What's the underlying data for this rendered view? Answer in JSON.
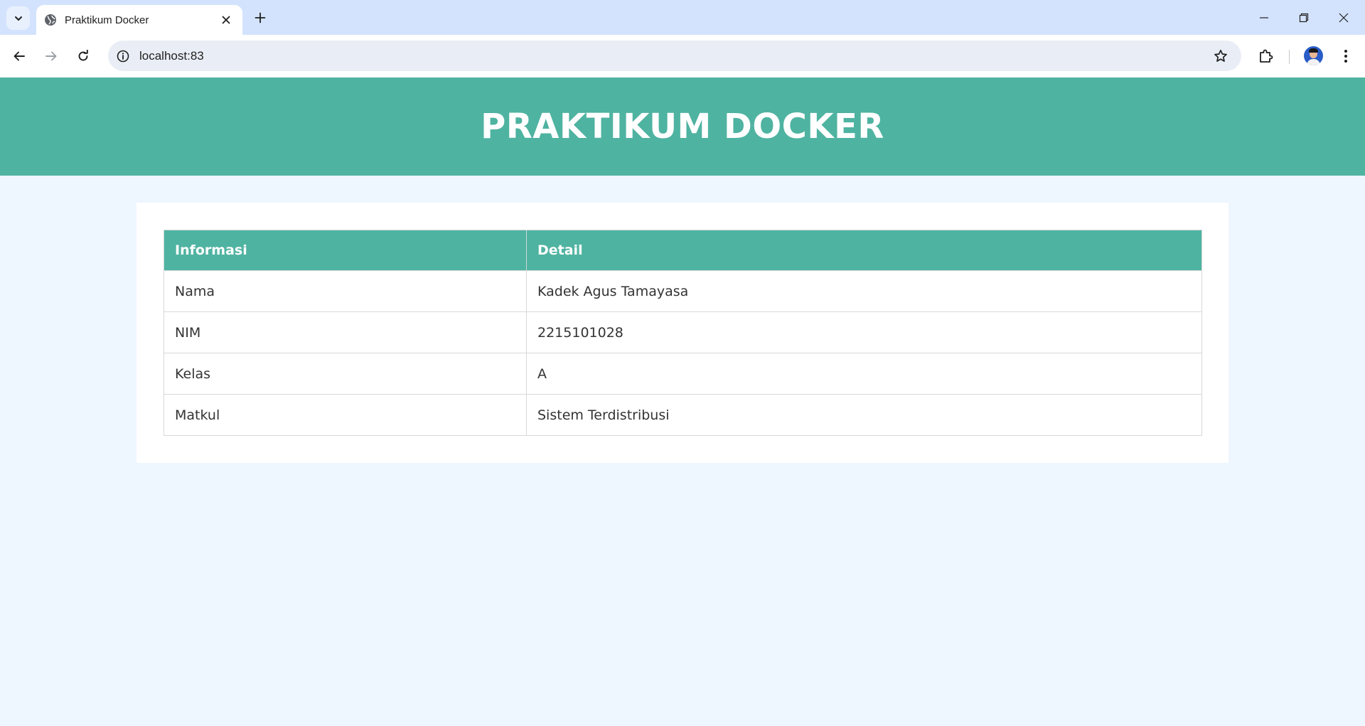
{
  "browser": {
    "tab_title": "Praktikum Docker",
    "url": "localhost:83",
    "icons": {
      "tab_search": "chevron-down-icon",
      "favicon": "globe-icon",
      "tab_close": "close-icon",
      "new_tab": "plus-icon",
      "minimize": "minimize-icon",
      "restore": "restore-icon",
      "close_window": "close-window-icon",
      "back": "back-arrow-icon",
      "forward": "forward-arrow-icon",
      "reload": "reload-icon",
      "site_info": "info-icon",
      "bookmark": "star-icon",
      "extensions": "puzzle-icon",
      "menu": "kebab-menu-icon"
    }
  },
  "page": {
    "heading": "PRAKTIKUM DOCKER",
    "table": {
      "headers": [
        "Informasi",
        "Detail"
      ],
      "rows": [
        [
          "Nama",
          "Kadek Agus Tamayasa"
        ],
        [
          "NIM",
          "2215101028"
        ],
        [
          "Kelas",
          "A"
        ],
        [
          "Matkul",
          "Sistem Terdistribusi"
        ]
      ]
    }
  },
  "colors": {
    "accent": "#4fb3a1",
    "page_background": "#eef6ff",
    "tabstrip_background": "#d3e3fd"
  }
}
